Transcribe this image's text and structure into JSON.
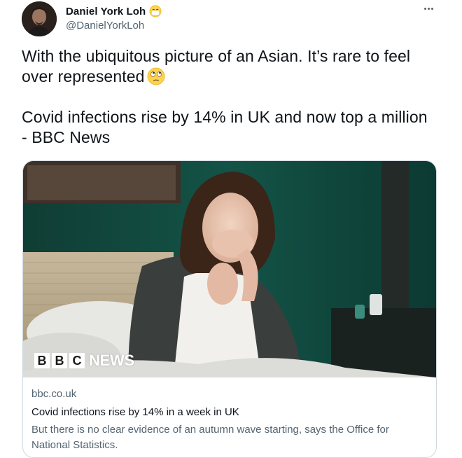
{
  "tweet": {
    "display_name": "Daniel York Loh",
    "handle": "@DanielYorkLoh",
    "name_emoji": "face-with-medical-mask-icon",
    "text_lines": [
      "With the ubiquitous picture of an Asian. It’s rare to feel over represented",
      "Covid infections rise by 14% in UK and now top a million - BBC News"
    ],
    "text_emoji": "face-with-rolling-eyes-icon"
  },
  "card": {
    "logo_letters": [
      "B",
      "B",
      "C"
    ],
    "logo_word": "NEWS",
    "domain": "bbc.co.uk",
    "title": "Covid infections rise by 14% in a week in UK",
    "description": "But there is no clear evidence of an autumn wave starting, says the Office for National Statistics."
  },
  "colors": {
    "text_primary": "#0f1419",
    "text_secondary": "#536471",
    "border": "#cfd9de",
    "photo_wall": "#114a3f"
  }
}
